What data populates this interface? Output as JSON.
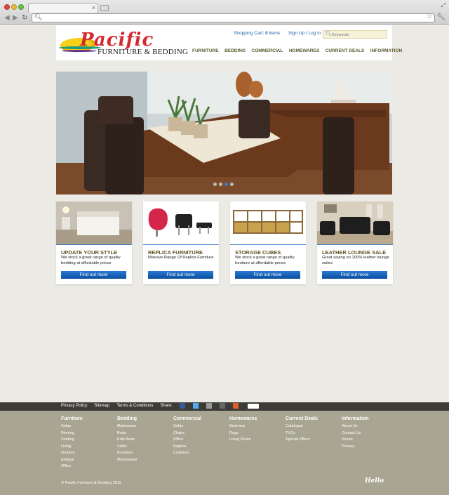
{
  "browser": {
    "tab_close": "×",
    "nav": {
      "back": "◀",
      "forward": "▶",
      "reload": "↻"
    },
    "omnibox_value": "",
    "icons": [
      "search-icon",
      "star-icon",
      "wrench-icon"
    ]
  },
  "header": {
    "logo_name": "Pacific",
    "logo_sub": "FURNITURE & BEDDING",
    "cart_label": "Shopping Cart: ",
    "cart_count": "0",
    "cart_items": " items",
    "signup": "Sign Up / Log In",
    "search_placeholder": "Keywords",
    "nav": [
      "FURNITURE",
      "BEDDING",
      "COMMERCIAL",
      "HOMEWARES",
      "CURRENT DEALS",
      "INFORMATION"
    ]
  },
  "hero": {
    "active_dot": 3,
    "dot_count": 4
  },
  "cards": [
    {
      "title": "UPDATE YOUR STYLE",
      "desc": "We stock a great range of quality bedding at affordable prices",
      "button": "Find out more"
    },
    {
      "title": "REPLICA FURNITURE",
      "desc": "Massive Range Of Replica Furniture",
      "button": "Find out more"
    },
    {
      "title": "STORAGE CUBES",
      "desc": "We stock a great range of quality furniture at affordable prices",
      "button": "Find out more"
    },
    {
      "title": "LEATHER LOUNGE SALE",
      "desc": "Great saving on 100% leather lounge suites",
      "button": "Find out more"
    }
  ],
  "footbar": {
    "links": [
      "Privacy Policy",
      "Sitemap",
      "Terms & Conditions"
    ],
    "share_label": "Share:",
    "colors": {
      "facebook": "#3b5998",
      "twitter": "#55acee",
      "email": "#999999",
      "print": "#666666",
      "plus": "#e25d2a"
    }
  },
  "footer": {
    "columns": [
      {
        "heading": "Furniture",
        "items": [
          "Sofas",
          "Dinning",
          "Seating",
          "Living",
          "Outdoor",
          "Antique",
          "Office"
        ]
      },
      {
        "heading": "Bedding",
        "items": [
          "Mattresses",
          "Beds",
          "Kids Beds",
          "Sides",
          "Furniture",
          "Manchester"
        ]
      },
      {
        "heading": "Commercial",
        "items": [
          "Sofas",
          "Chairs",
          "Office",
          "Replica",
          "Cushions"
        ]
      },
      {
        "heading": "Homewares",
        "items": [
          "Bedroom",
          "Rugs",
          "Living Room"
        ]
      },
      {
        "heading": "Current Deals",
        "items": [
          "Catalogue",
          "TVCs",
          "Special Offers"
        ]
      },
      {
        "heading": "Information",
        "items": [
          "About Us",
          "Contact Us",
          "Stores",
          "Privacy"
        ]
      }
    ],
    "copyright": "© Pacific Furniture & Bedding 2011",
    "hello_mark": "Hello"
  }
}
